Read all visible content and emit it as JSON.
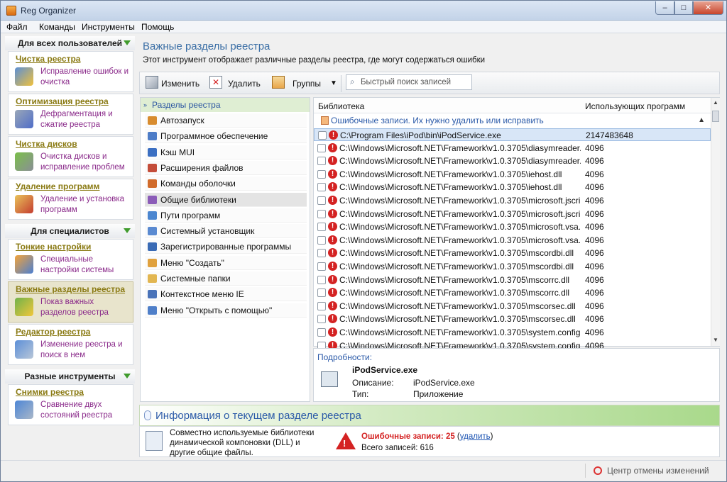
{
  "window": {
    "title": "Reg Organizer",
    "min": "–",
    "max": "□",
    "close": "✕"
  },
  "menu": [
    "Файл",
    "Команды",
    "Инструменты",
    "Помощь"
  ],
  "sidebar": {
    "sections": [
      "Для всех пользователей",
      "Для специалистов",
      "Разные инструменты"
    ],
    "tools": [
      {
        "title": "Чистка реестра",
        "desc": "Исправление ошибок и очистка",
        "icon": "registry-clean-icon"
      },
      {
        "title": "Оптимизация реестра",
        "desc": "Дефрагментация и сжатие реестра",
        "icon": "optimize-icon"
      },
      {
        "title": "Чистка дисков",
        "desc": "Очистка дисков и исправление проблем",
        "icon": "disk-clean-icon"
      },
      {
        "title": "Удаление программ",
        "desc": "Удаление и установка программ",
        "icon": "uninstall-icon"
      },
      {
        "title": "Тонкие настройки",
        "desc": "Специальные настройки системы",
        "icon": "tweaks-icon"
      },
      {
        "title": "Важные разделы реестра",
        "desc": "Показ важных разделов реестра",
        "icon": "important-keys-icon"
      },
      {
        "title": "Редактор реестра",
        "desc": "Изменение реестра и поиск в нем",
        "icon": "registry-editor-icon"
      },
      {
        "title": "Снимки реестра",
        "desc": "Сравнение двух состояний реестра",
        "icon": "snapshot-icon"
      }
    ]
  },
  "header": {
    "title": "Важные разделы реестра",
    "desc": "Этот инструмент отображает различные разделы реестра, где могут содержаться ошибки"
  },
  "toolbar": {
    "edit": "Изменить",
    "delete": "Удалить",
    "groups": "Группы",
    "search_placeholder": "Быстрый поиск записей"
  },
  "categories": {
    "header": "Разделы реестра",
    "items": [
      "Автозапуск",
      "Программное обеспечение",
      "Кэш MUI",
      "Расширения файлов",
      "Команды оболочки",
      "Общие библиотеки",
      "Пути программ",
      "Системный установщик",
      "Зарегистрированные программы",
      "Меню \"Создать\"",
      "Системные папки",
      "Контекстное меню IE",
      "Меню \"Открыть с помощью\""
    ],
    "active_index": 5
  },
  "table": {
    "columns": [
      "Библиотека",
      "Использующих программ"
    ],
    "group": "Ошибочные записи. Их нужно удалить или исправить",
    "rows": [
      {
        "path": "C:\\Program Files\\iPod\\bin\\iPodService.exe",
        "count": "2147483648"
      },
      {
        "path": "C:\\Windows\\Microsoft.NET\\Framework\\v1.0.3705\\diasymreader.dll",
        "count": "4096"
      },
      {
        "path": "C:\\Windows\\Microsoft.NET\\Framework\\v1.0.3705\\diasymreader.dll",
        "count": "4096"
      },
      {
        "path": "C:\\Windows\\Microsoft.NET\\Framework\\v1.0.3705\\iehost.dll",
        "count": "4096"
      },
      {
        "path": "C:\\Windows\\Microsoft.NET\\Framework\\v1.0.3705\\iehost.dll",
        "count": "4096"
      },
      {
        "path": "C:\\Windows\\Microsoft.NET\\Framework\\v1.0.3705\\microsoft.jscript...",
        "count": "4096"
      },
      {
        "path": "C:\\Windows\\Microsoft.NET\\Framework\\v1.0.3705\\microsoft.jscript...",
        "count": "4096"
      },
      {
        "path": "C:\\Windows\\Microsoft.NET\\Framework\\v1.0.3705\\microsoft.vsa.v...",
        "count": "4096"
      },
      {
        "path": "C:\\Windows\\Microsoft.NET\\Framework\\v1.0.3705\\microsoft.vsa.v...",
        "count": "4096"
      },
      {
        "path": "C:\\Windows\\Microsoft.NET\\Framework\\v1.0.3705\\mscordbi.dll",
        "count": "4096"
      },
      {
        "path": "C:\\Windows\\Microsoft.NET\\Framework\\v1.0.3705\\mscordbi.dll",
        "count": "4096"
      },
      {
        "path": "C:\\Windows\\Microsoft.NET\\Framework\\v1.0.3705\\mscorrc.dll",
        "count": "4096"
      },
      {
        "path": "C:\\Windows\\Microsoft.NET\\Framework\\v1.0.3705\\mscorrc.dll",
        "count": "4096"
      },
      {
        "path": "C:\\Windows\\Microsoft.NET\\Framework\\v1.0.3705\\mscorsec.dll",
        "count": "4096"
      },
      {
        "path": "C:\\Windows\\Microsoft.NET\\Framework\\v1.0.3705\\mscorsec.dll",
        "count": "4096"
      },
      {
        "path": "C:\\Windows\\Microsoft.NET\\Framework\\v1.0.3705\\system.configur...",
        "count": "4096"
      },
      {
        "path": "C:\\Windows\\Microsoft.NET\\Framework\\v1.0.3705\\system.configur...",
        "count": "4096"
      }
    ],
    "selected_index": 0
  },
  "details": {
    "label": "Подробности:",
    "name": "iPodService.exe",
    "desc_key": "Описание:",
    "desc_val": "iPodService.exe",
    "type_key": "Тип:",
    "type_val": "Приложение"
  },
  "info": {
    "title": "Информация о текущем разделе реестра",
    "desc": "Совместно используемые библиотеки динамической компоновки (DLL) и другие общие файлы.",
    "errors_label": "Ошибочные записи: 25",
    "delete_link": "удалить",
    "total": "Всего записей: 616"
  },
  "status": {
    "undo_center": "Центр отмены изменений"
  },
  "colors": {
    "accent": "#2b5aa8",
    "tool_title": "#8a7a13",
    "tool_desc": "#8a2a8a",
    "error": "#d42222",
    "green": "#3f9b2c"
  }
}
